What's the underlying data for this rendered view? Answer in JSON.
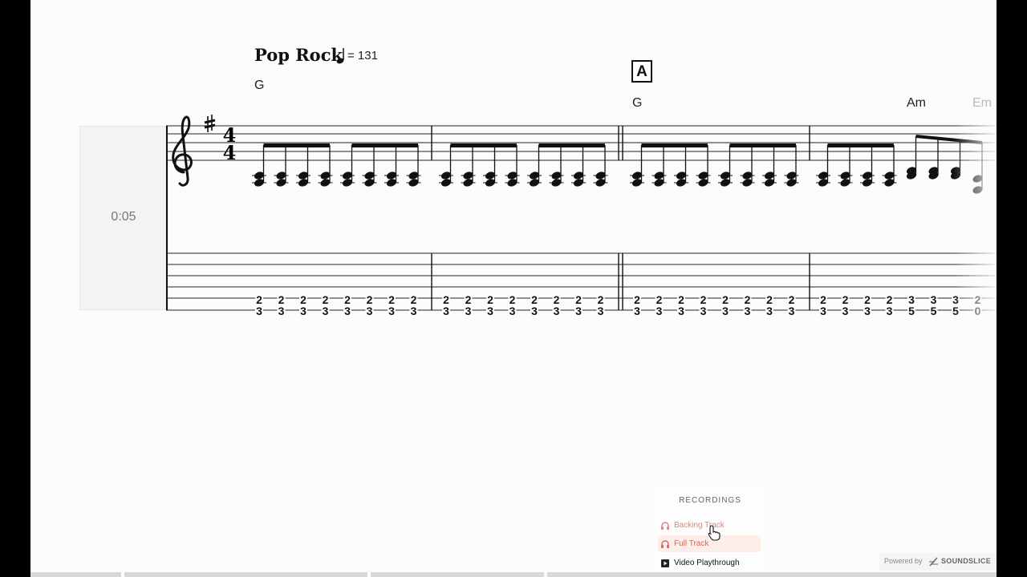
{
  "score": {
    "style": "Pop Rock",
    "tempo": "= 131",
    "time": "0:05",
    "section_marker": "A",
    "time_signature": {
      "top": "4",
      "bottom": "4"
    },
    "chords": [
      {
        "label": "G",
        "name": "chord-g-1"
      },
      {
        "label": "G",
        "name": "chord-g-2"
      },
      {
        "label": "Am",
        "name": "chord-am"
      },
      {
        "label": "Em",
        "name": "chord-em"
      }
    ],
    "tab_pairs": [
      [
        "2",
        "3"
      ],
      [
        "2",
        "3"
      ],
      [
        "2",
        "3"
      ],
      [
        "2",
        "3"
      ],
      [
        "2",
        "3"
      ],
      [
        "2",
        "3"
      ],
      [
        "2",
        "3"
      ],
      [
        "2",
        "3"
      ],
      [
        "2",
        "3"
      ],
      [
        "2",
        "3"
      ],
      [
        "2",
        "3"
      ],
      [
        "2",
        "3"
      ],
      [
        "2",
        "3"
      ],
      [
        "2",
        "3"
      ],
      [
        "2",
        "3"
      ],
      [
        "2",
        "3"
      ],
      [
        "2",
        "3"
      ],
      [
        "2",
        "3"
      ],
      [
        "2",
        "3"
      ],
      [
        "2",
        "3"
      ],
      [
        "2",
        "3"
      ],
      [
        "2",
        "3"
      ],
      [
        "2",
        "3"
      ],
      [
        "2",
        "3"
      ],
      [
        "2",
        "3"
      ],
      [
        "2",
        "3"
      ],
      [
        "2",
        "3"
      ],
      [
        "2",
        "3"
      ],
      [
        "3",
        "5"
      ],
      [
        "3",
        "5"
      ],
      [
        "3",
        "5"
      ],
      [
        "2",
        "0"
      ]
    ]
  },
  "recordings": {
    "header": "RECORDINGS",
    "items": [
      {
        "label": "Backing Track",
        "icon": "headphones-icon"
      },
      {
        "label": "Full Track",
        "icon": "headphones-icon"
      },
      {
        "label": "Video Playthrough",
        "icon": "video-play-icon"
      }
    ]
  },
  "footer": {
    "powered_by": "Powered by",
    "brand": "SOUNDSLICE"
  },
  "colors": {
    "accent": "#d06a5a",
    "page_bg": "#fcfcfc",
    "ink": "#111111"
  }
}
